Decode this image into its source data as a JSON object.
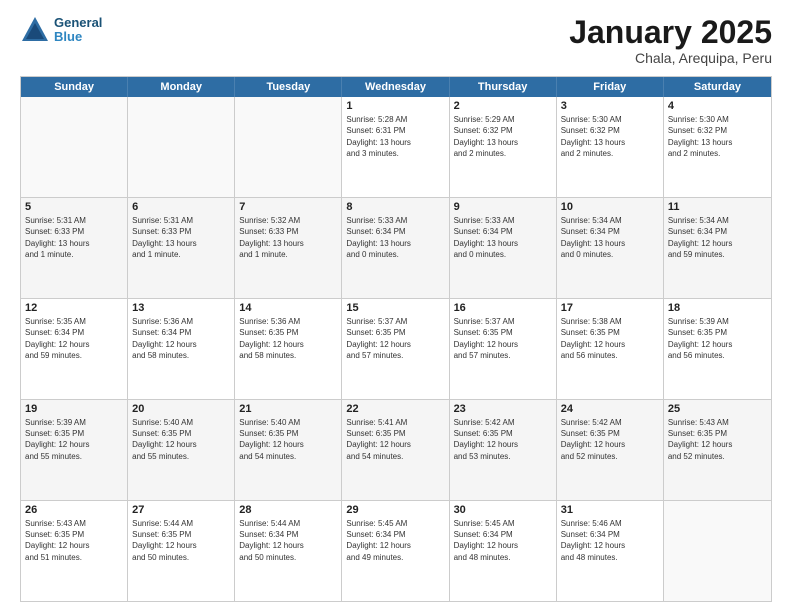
{
  "header": {
    "logo_line1": "General",
    "logo_line2": "Blue",
    "month": "January 2025",
    "location": "Chala, Arequipa, Peru"
  },
  "days_of_week": [
    "Sunday",
    "Monday",
    "Tuesday",
    "Wednesday",
    "Thursday",
    "Friday",
    "Saturday"
  ],
  "weeks": [
    [
      {
        "num": "",
        "info": ""
      },
      {
        "num": "",
        "info": ""
      },
      {
        "num": "",
        "info": ""
      },
      {
        "num": "1",
        "info": "Sunrise: 5:28 AM\nSunset: 6:31 PM\nDaylight: 13 hours\nand 3 minutes."
      },
      {
        "num": "2",
        "info": "Sunrise: 5:29 AM\nSunset: 6:32 PM\nDaylight: 13 hours\nand 2 minutes."
      },
      {
        "num": "3",
        "info": "Sunrise: 5:30 AM\nSunset: 6:32 PM\nDaylight: 13 hours\nand 2 minutes."
      },
      {
        "num": "4",
        "info": "Sunrise: 5:30 AM\nSunset: 6:32 PM\nDaylight: 13 hours\nand 2 minutes."
      }
    ],
    [
      {
        "num": "5",
        "info": "Sunrise: 5:31 AM\nSunset: 6:33 PM\nDaylight: 13 hours\nand 1 minute."
      },
      {
        "num": "6",
        "info": "Sunrise: 5:31 AM\nSunset: 6:33 PM\nDaylight: 13 hours\nand 1 minute."
      },
      {
        "num": "7",
        "info": "Sunrise: 5:32 AM\nSunset: 6:33 PM\nDaylight: 13 hours\nand 1 minute."
      },
      {
        "num": "8",
        "info": "Sunrise: 5:33 AM\nSunset: 6:34 PM\nDaylight: 13 hours\nand 0 minutes."
      },
      {
        "num": "9",
        "info": "Sunrise: 5:33 AM\nSunset: 6:34 PM\nDaylight: 13 hours\nand 0 minutes."
      },
      {
        "num": "10",
        "info": "Sunrise: 5:34 AM\nSunset: 6:34 PM\nDaylight: 13 hours\nand 0 minutes."
      },
      {
        "num": "11",
        "info": "Sunrise: 5:34 AM\nSunset: 6:34 PM\nDaylight: 12 hours\nand 59 minutes."
      }
    ],
    [
      {
        "num": "12",
        "info": "Sunrise: 5:35 AM\nSunset: 6:34 PM\nDaylight: 12 hours\nand 59 minutes."
      },
      {
        "num": "13",
        "info": "Sunrise: 5:36 AM\nSunset: 6:34 PM\nDaylight: 12 hours\nand 58 minutes."
      },
      {
        "num": "14",
        "info": "Sunrise: 5:36 AM\nSunset: 6:35 PM\nDaylight: 12 hours\nand 58 minutes."
      },
      {
        "num": "15",
        "info": "Sunrise: 5:37 AM\nSunset: 6:35 PM\nDaylight: 12 hours\nand 57 minutes."
      },
      {
        "num": "16",
        "info": "Sunrise: 5:37 AM\nSunset: 6:35 PM\nDaylight: 12 hours\nand 57 minutes."
      },
      {
        "num": "17",
        "info": "Sunrise: 5:38 AM\nSunset: 6:35 PM\nDaylight: 12 hours\nand 56 minutes."
      },
      {
        "num": "18",
        "info": "Sunrise: 5:39 AM\nSunset: 6:35 PM\nDaylight: 12 hours\nand 56 minutes."
      }
    ],
    [
      {
        "num": "19",
        "info": "Sunrise: 5:39 AM\nSunset: 6:35 PM\nDaylight: 12 hours\nand 55 minutes."
      },
      {
        "num": "20",
        "info": "Sunrise: 5:40 AM\nSunset: 6:35 PM\nDaylight: 12 hours\nand 55 minutes."
      },
      {
        "num": "21",
        "info": "Sunrise: 5:40 AM\nSunset: 6:35 PM\nDaylight: 12 hours\nand 54 minutes."
      },
      {
        "num": "22",
        "info": "Sunrise: 5:41 AM\nSunset: 6:35 PM\nDaylight: 12 hours\nand 54 minutes."
      },
      {
        "num": "23",
        "info": "Sunrise: 5:42 AM\nSunset: 6:35 PM\nDaylight: 12 hours\nand 53 minutes."
      },
      {
        "num": "24",
        "info": "Sunrise: 5:42 AM\nSunset: 6:35 PM\nDaylight: 12 hours\nand 52 minutes."
      },
      {
        "num": "25",
        "info": "Sunrise: 5:43 AM\nSunset: 6:35 PM\nDaylight: 12 hours\nand 52 minutes."
      }
    ],
    [
      {
        "num": "26",
        "info": "Sunrise: 5:43 AM\nSunset: 6:35 PM\nDaylight: 12 hours\nand 51 minutes."
      },
      {
        "num": "27",
        "info": "Sunrise: 5:44 AM\nSunset: 6:35 PM\nDaylight: 12 hours\nand 50 minutes."
      },
      {
        "num": "28",
        "info": "Sunrise: 5:44 AM\nSunset: 6:34 PM\nDaylight: 12 hours\nand 50 minutes."
      },
      {
        "num": "29",
        "info": "Sunrise: 5:45 AM\nSunset: 6:34 PM\nDaylight: 12 hours\nand 49 minutes."
      },
      {
        "num": "30",
        "info": "Sunrise: 5:45 AM\nSunset: 6:34 PM\nDaylight: 12 hours\nand 48 minutes."
      },
      {
        "num": "31",
        "info": "Sunrise: 5:46 AM\nSunset: 6:34 PM\nDaylight: 12 hours\nand 48 minutes."
      },
      {
        "num": "",
        "info": ""
      }
    ]
  ]
}
